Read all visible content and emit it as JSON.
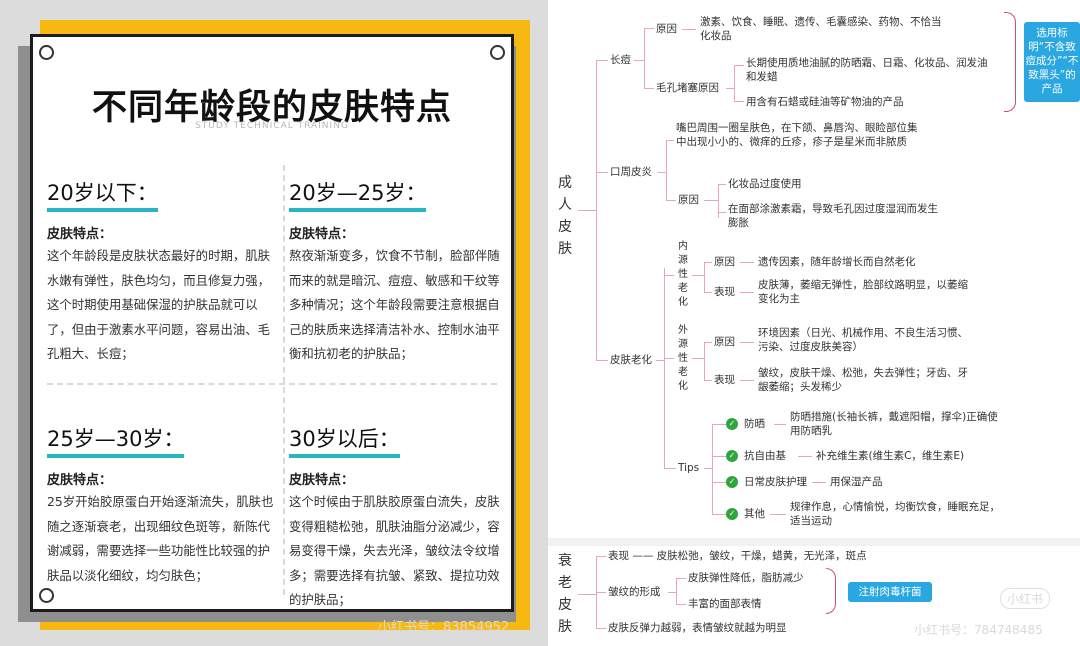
{
  "left": {
    "title": "不同年龄段的皮肤特点",
    "subtitle": "STUDY TECHNICAL TRAINING",
    "sections": [
      {
        "heading": "20岁以下：",
        "label": "皮肤特点：",
        "text": "这个年龄段是皮肤状态最好的时期，肌肤水嫩有弹性，肤色均匀，而且修复力强，这个时期使用基础保湿的护肤品就可以了，但由于激素水平问题，容易出油、毛孔粗大、长痘；"
      },
      {
        "heading": "20岁—25岁：",
        "label": "皮肤特点：",
        "text": "熬夜渐渐变多，饮食不节制，脸部伴随而来的就是暗沉、痘痘、敏感和干纹等多种情况；这个年龄段需要注意根据自己的肤质来选择清洁补水、控制水油平衡和抗初老的护肤品；"
      },
      {
        "heading": "25岁—30岁：",
        "label": "皮肤特点：",
        "text": "25岁开始胶原蛋白开始逐渐流失，肌肤也随之逐渐衰老，出现细纹色斑等，新陈代谢减弱，需要选择一些功能性比较强的护肤品以淡化细纹，均匀肤色；"
      },
      {
        "heading": "30岁以后：",
        "label": "皮肤特点：",
        "text": "这个时候由于肌肤胶原蛋白流失，皮肤变得粗糙松弛，肌肤油脂分泌减少，容易变得干燥，失去光泽，皱纹法令纹增多；需要选择有抗皱、紧致、提拉功效的护肤品；"
      }
    ],
    "watermark": "小红书号：83854952"
  },
  "right": {
    "root1": "成人皮肤",
    "acne": {
      "label": "长痘",
      "cause_label": "原因",
      "cause_text": "激素、饮食、睡眠、遗传、毛囊感染、药物、不恰当化妆品",
      "pore_label": "毛孔堵塞原因",
      "pore_1": "长期使用质地油腻的防晒霜、日霜、化妆品、润发油和发蜡",
      "pore_2": "用含有石蜡或硅油等矿物油的产品",
      "tip": "选用标明“不含致痘成分”“不致黑头”的产品"
    },
    "perioral": {
      "label": "口周皮炎",
      "desc": "嘴巴周围一圈呈肤色，在下颌、鼻唇沟、眼睑部位集中出现小小的、微痒的丘疹，疹子是星米而非脓质",
      "cause_label": "原因",
      "cause_1": "化妆品过度使用",
      "cause_2": "在面部涂激素霜，导致毛孔因过度湿润而发生膨胀"
    },
    "aging": {
      "label": "皮肤老化",
      "intrinsic_label": "内源性老化",
      "intrinsic_cause_label": "原因",
      "intrinsic_cause": "遗传因素，随年龄增长而自然老化",
      "intrinsic_sign_label": "表现",
      "intrinsic_sign": "皮肤薄，萎缩无弹性，脸部纹路明显，以萎缩变化为主",
      "extrinsic_label": "外源性老化",
      "extrinsic_cause_label": "原因",
      "extrinsic_cause": "环境因素（日光、机械作用、不良生活习惯、污染、过度皮肤美容）",
      "extrinsic_sign_label": "表现",
      "extrinsic_sign": "皱纹，皮肤干燥、松弛，失去弹性；牙齿、牙龈萎缩；头发稀少",
      "tips_label": "Tips",
      "tips": [
        {
          "name": "防晒",
          "text": "防晒措施(长袖长裤，戴遮阳帽，撑伞)正确使用防晒乳"
        },
        {
          "name": "抗自由基",
          "text": "补充维生素(维生素C，维生素E)"
        },
        {
          "name": "日常皮肤护理",
          "text": "用保湿产品"
        },
        {
          "name": "其他",
          "text": "规律作息，心情愉悦，均衡饮食，睡眠充足，适当运动"
        }
      ]
    },
    "root2": "衰老皮肤",
    "old": {
      "sign": "表现 —— 皮肤松弛，皱纹，干燥，蜡黄，无光泽，斑点",
      "wrinkle_label": "皱纹的形成",
      "wrinkle_1": "皮肤弹性降低，脂肪减少",
      "wrinkle_2": "丰富的面部表情",
      "treatment": "注射肉毒杆菌",
      "last": "皮肤反弹力越弱，表情皱纹就越为明显"
    },
    "watermark": "小红书号：784748485",
    "watermark_brand": "小红书"
  },
  "colors": {
    "accent_yellow": "#f7b90f",
    "accent_teal": "#27b5c4",
    "accent_blue": "#2aa7e0",
    "check_green": "#2fa53b",
    "branch_pink": "#e7a7b9"
  }
}
